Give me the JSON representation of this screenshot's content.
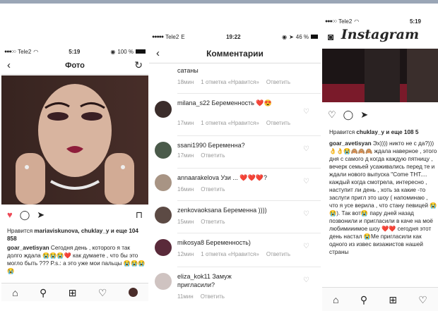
{
  "phone1": {
    "status": {
      "carrier": "Tele2",
      "time": "5:19",
      "battery": "100 %"
    },
    "nav": {
      "title": "Фото"
    },
    "likes": {
      "prefix": "Нравится ",
      "users": "mariaviskunova, chuklay_y",
      "suffix": " и еще 104 858"
    },
    "caption": {
      "user": "goar_avetisyan",
      "text": " Сегодня день , которого я так долго ждала 😭😭😭❤️ как думаете , что бы это могло быть ??? P.s.: а это уже мои пальцы 😭😭😭😭"
    }
  },
  "phone2": {
    "status": {
      "carrier": "Tele2",
      "network": "E",
      "time": "19:22",
      "battery": "46 %"
    },
    "nav": {
      "title": "Комментарии"
    },
    "top": {
      "text": "сатаны",
      "time": "18мин",
      "likes": "1 отметка «Нравится»",
      "reply": "Ответить"
    },
    "comments": [
      {
        "user": "milana_s22",
        "text": " Беременность ❤️😍",
        "time": "17мин",
        "likes": "1 отметка «Нравится»",
        "reply": "Ответить"
      },
      {
        "user": "ssani1990",
        "text": " Беременна?",
        "time": "17мин",
        "likes": "",
        "reply": "Ответить"
      },
      {
        "user": "annaarakelova",
        "text": " Узи ... ❤️❤️❤️?",
        "time": "16мин",
        "likes": "",
        "reply": "Ответить"
      },
      {
        "user": "zenkovaoksana",
        "text": " Беременна ))))",
        "time": "15мин",
        "likes": "",
        "reply": "Ответить"
      },
      {
        "user": "mikosya8",
        "text": " Беременность)",
        "time": "12мин",
        "likes": "1 отметка «Нравится»",
        "reply": "Ответить"
      },
      {
        "user": "eliza_kok11",
        "text": " Замуж пригласили?",
        "time": "11мин",
        "likes": "",
        "reply": "Ответить"
      }
    ]
  },
  "phone3": {
    "status": {
      "carrier": "Tele2",
      "time": "5:19"
    },
    "logo": "Instagram",
    "likes": {
      "prefix": "Нравится ",
      "users": "chuklay_y",
      "suffix": " и еще 108 5"
    },
    "caption": {
      "user": "goar_avetisyan",
      "text": " Эх)))) никто не с да?)))👌👌😭🙈🙈🙈 ждала наверное , этого дня с самого д когда каждую пятницу , вечерк семьей усаживались перед те и ждали нового выпуска \"Come ТНТ.... каждый когда смотрела, интересно , наступит ли день , хоть за какие -то заслуги пригл это шоу ( напоминаю , что я усе верила , что стану певицей 😭 😭). Так вот😭 пару дней назад позвонили и пригласили в каче на моё любимииимое шоу ❤️❤️ сегодня этот день настал 😭Ме пригласили как одного из извес визажистов нашей страны"
    }
  }
}
